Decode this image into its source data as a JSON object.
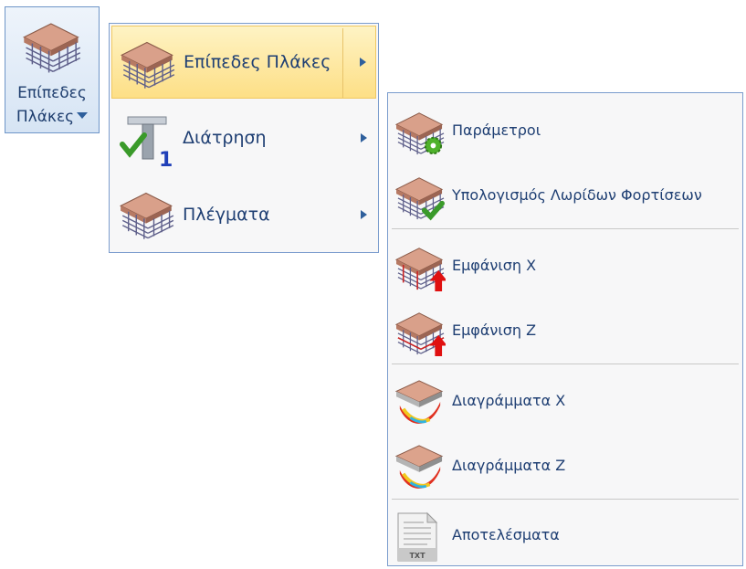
{
  "ribbon_button": {
    "line1": "Επίπεδες",
    "line2": "Πλάκες",
    "icon": "slab-grid-icon"
  },
  "menu": {
    "items": [
      {
        "label": "Επίπεδες Πλάκες",
        "icon": "slab-grid-icon",
        "highlighted": true,
        "has_submenu": true
      },
      {
        "label": "Διάτρηση",
        "icon": "punching-column-icon",
        "has_submenu": true
      },
      {
        "label": "Πλέγματα",
        "icon": "mesh-grid-icon",
        "has_submenu": true
      }
    ]
  },
  "submenu": {
    "items": [
      {
        "label": "Παράμετροι",
        "icon": "slab-settings-icon"
      },
      {
        "label": "Υπολογισμός Λωρίδων Φορτίσεων",
        "icon": "slab-check-icon"
      },
      {
        "label": "Εμφάνιση X",
        "icon": "slab-arrow-x-icon"
      },
      {
        "label": "Εμφάνιση Z",
        "icon": "slab-arrow-z-icon"
      },
      {
        "label": "Διαγράμματα X",
        "icon": "diagram-x-icon"
      },
      {
        "label": "Διαγράμματα Z",
        "icon": "diagram-z-icon"
      },
      {
        "label": "Αποτελέσματα",
        "icon": "txt-document-icon",
        "icon_caption": "TXT"
      }
    ]
  },
  "colors": {
    "highlight_top": "#fef3c4",
    "highlight_bottom": "#fddf86",
    "menu_border": "#7a9ccd",
    "text": "#1f3f73"
  }
}
